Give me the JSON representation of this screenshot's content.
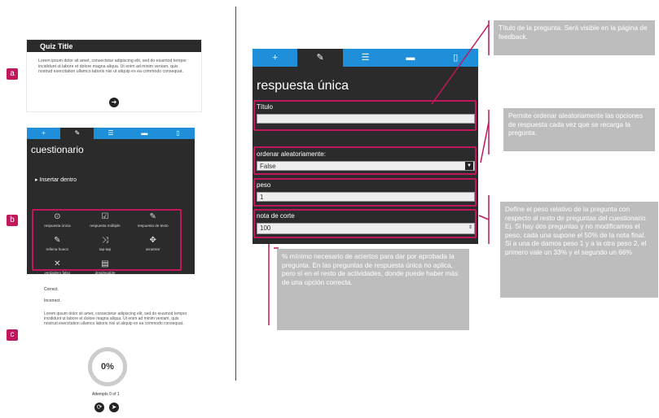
{
  "labels": {
    "a": "a",
    "b": "b",
    "c": "c"
  },
  "quiz": {
    "title": "Quiz Title",
    "body": "Lorem ipsum dolor sit amet, consectetur adipiscing elit, sed do eiusmod tempor incididunt ut labore et dolore magna aliqua. Ut enim ad minim veniam, quis nostrud exercitation ullamco laboris nisi ut aliquip ex ea commodo consequat.",
    "next": "➜"
  },
  "small_editor": {
    "tabs": [
      "+",
      "✎",
      "☰",
      "▬",
      "▯"
    ],
    "title": "cuestionario",
    "insert": "▸ Insertar dentro",
    "items": [
      {
        "icon": "⊙",
        "label": "respuesta única"
      },
      {
        "icon": "☑",
        "label": "respuesta múltiple"
      },
      {
        "icon": "✎",
        "label": "respuesta de texto"
      },
      {
        "icon": "✎",
        "label": "rellena hueco"
      },
      {
        "icon": "⤨",
        "label": "tap-tap"
      },
      {
        "icon": "✥",
        "label": "arrastrar"
      },
      {
        "icon": "✕",
        "label": "verdadero falso"
      },
      {
        "icon": "▤",
        "label": "desplegable"
      }
    ]
  },
  "result": {
    "correct": "Correct.",
    "incorrect": "Incorrect.",
    "body": "Lorem ipsum dolor sit amet, consectetur adipiscing elit, sed do eiusmod tempor incididunt ut labore et dolore magna aliqua. Ut enim ad minim veniam, quis nostrud exercitation ullamco laboris nisi ut aliquip ex ea commodo consequat.",
    "percent": "0%",
    "attempts": "Attempts 0 of 1",
    "retry": "⟳",
    "share": "➤"
  },
  "editor": {
    "tabs": [
      "+",
      "✎",
      "☰",
      "▬",
      "▯"
    ],
    "title": "respuesta única",
    "titulo_label": "Título",
    "titulo_value": "",
    "orden_label": "ordenar aleatoriamente:",
    "orden_value": "False",
    "peso_label": "peso",
    "peso_value": "1",
    "nota_label": "nota de corte",
    "nota_value": "100"
  },
  "callouts": {
    "c1": "Título de la pregunta. Será visible en la página de feedback.",
    "c2": "Permite ordenar aleatoriamente las opciones de respuesta cada vez que se recarga la pregunta.",
    "c3": "Define el peso relativo de la pregunta con respecto al resto de preguntas del cuestionario. Ej. Si hay dos preguntas y no modificamos el peso, cada una supone el 50% de la nota final. Si a una de damos peso 1 y a la otra peso 2, el primero vale un 33% y el segundo un 66%",
    "c4": "% mínimo necesario de aciertos para dar por aprobada la pregunta.  En las preguntas de respuesta única no aplica, pero sí en el resto de actividades, donde puede haber más de una opción correcta."
  },
  "colors": {
    "accent": "#c0175d",
    "tab_blue": "#1e8fd8",
    "panel": "#2b2b2b",
    "callout": "#bdbdbd"
  }
}
